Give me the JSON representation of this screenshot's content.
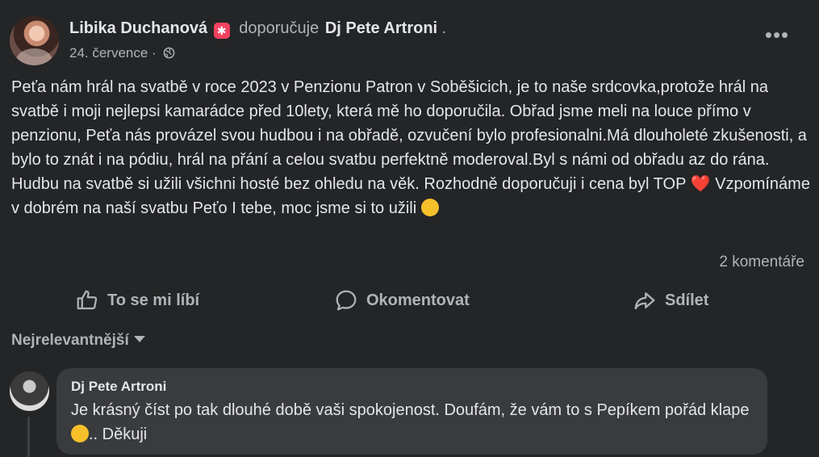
{
  "post": {
    "author": "Libika Duchanová",
    "recommends": "doporučuje",
    "page": "Dj Pete Artroni",
    "dot": ".",
    "date": "24. července",
    "date_separator": "·",
    "more_label": "•••",
    "text_part1": "Peťa nám hrál na svatbě v roce 2023 v Penzionu Patron v Soběšicich,  je to naše srdcovka,protože hrál na svatbě i moji nejlepsi kamarádce před 10lety, která mě ho doporučila. Obřad jsme meli na louce přímo v penzionu, Peťa nás provázel svou hudbou i na obřadě, ozvučení bylo profesionalni.Má dlouholeté zkušenosti, a bylo to znát i na pódiu, hrál na přání a celou svatbu perfektně moderoval.Byl s námi od obřadu az do rána. Hudbu na svatbě si užili všichni hosté bez ohledu na věk. Rozhodně doporučuji i cena byl TOP",
    "heart": "❤️",
    "text_part2": "Vzpomínáme v dobrém na naší svatbu Peťo I tebe,  moc jsme si to užili",
    "comment_count": "2 komentáře"
  },
  "actions": {
    "like": "To se mi líbí",
    "comment": "Okomentovat",
    "share": "Sdílet"
  },
  "sort_label": "Nejrelevantnější",
  "comment": {
    "author": "Dj Pete Artroni",
    "text_part1": "Je krásný číst po tak dlouhé době vaši spokojenost. Doufám, že vám to s Pepíkem pořád klape",
    "text_part2": ".. Děkuji"
  },
  "icons": {
    "badge": "star-badge-icon",
    "privacy": "globe-icon",
    "like": "thumbs-up-icon",
    "comment": "speech-bubble-icon",
    "share": "share-arrow-icon"
  },
  "colors": {
    "background": "#242526",
    "comment_bubble": "#3a3b3c",
    "text_primary": "#e4e6eb",
    "text_secondary": "#b0b3b8",
    "badge": "#f3425f"
  }
}
